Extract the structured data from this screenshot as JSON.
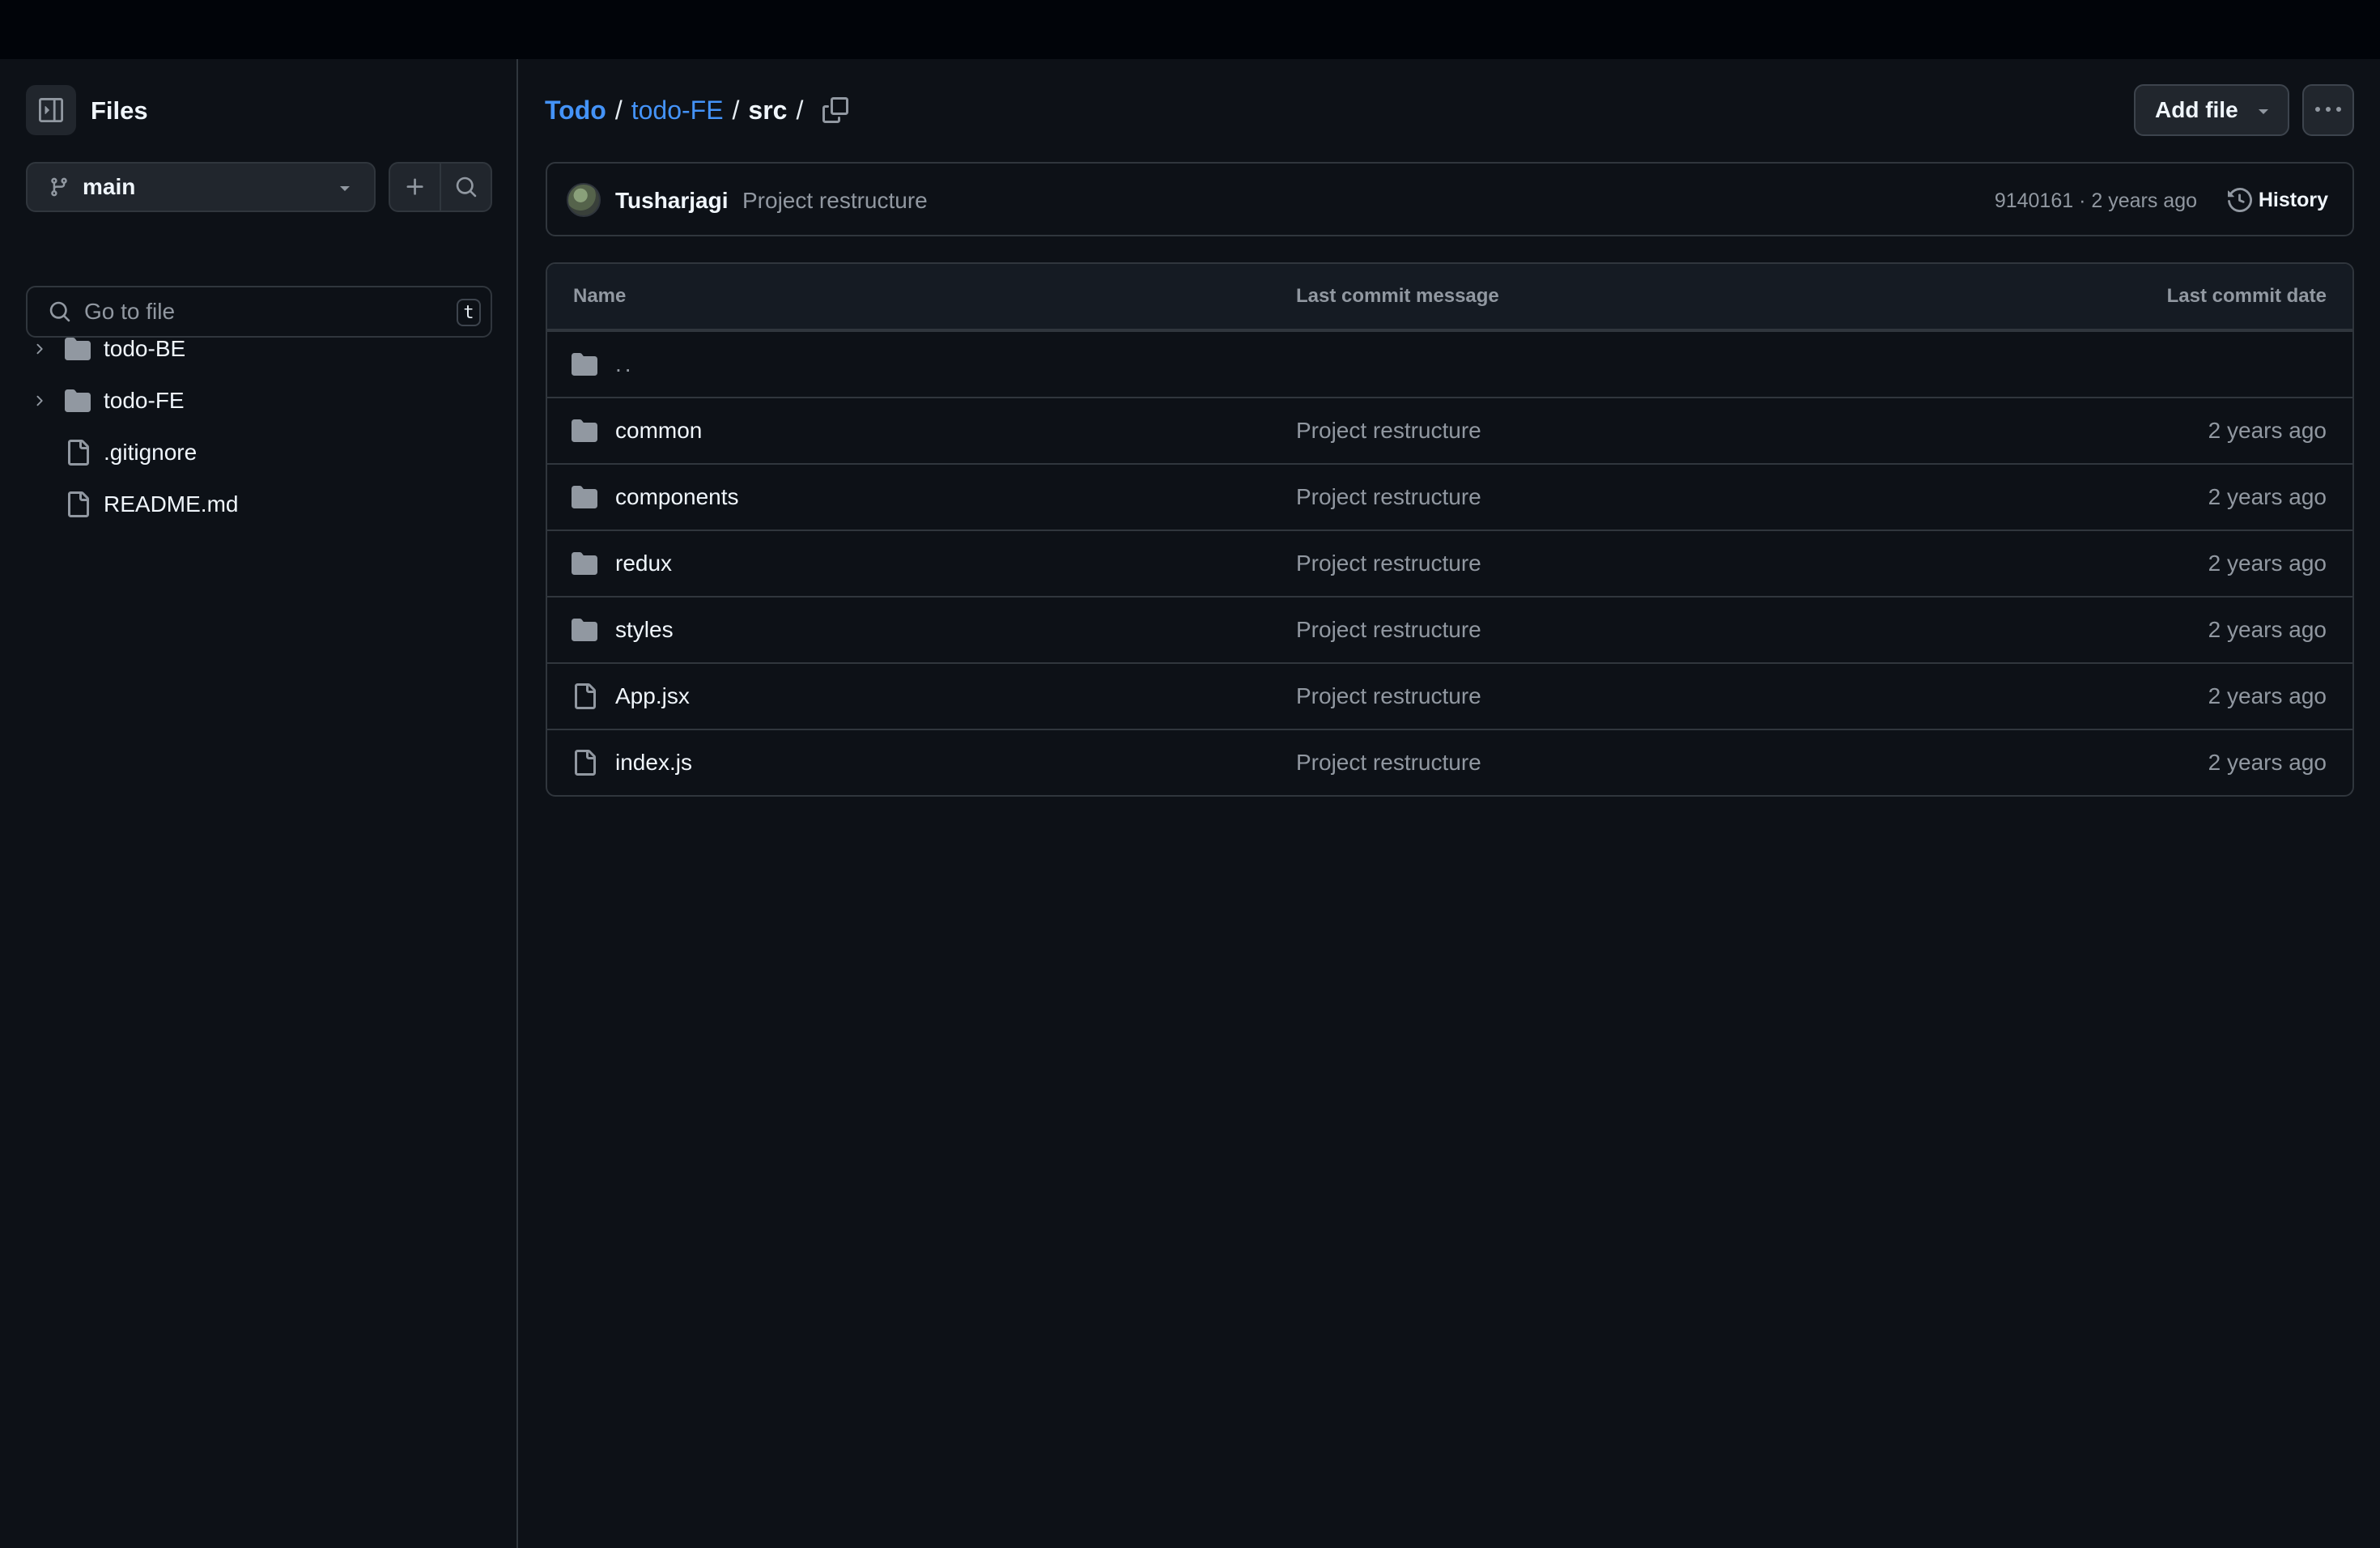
{
  "sidebar": {
    "title": "Files",
    "branch": "main",
    "search_placeholder": "Go to file",
    "search_shortcut": "t",
    "tree": [
      {
        "label": "todo-BE",
        "type": "folder",
        "expandable": true
      },
      {
        "label": "todo-FE",
        "type": "folder",
        "expandable": true
      },
      {
        "label": ".gitignore",
        "type": "file",
        "expandable": false
      },
      {
        "label": "README.md",
        "type": "file",
        "expandable": false
      }
    ]
  },
  "breadcrumb": {
    "repo": "Todo",
    "dir": "todo-FE",
    "current": "src",
    "separator": "/"
  },
  "actions": {
    "add_file": "Add file"
  },
  "commit": {
    "author": "Tusharjagi",
    "message": "Project restructure",
    "meta": "9140161 · 2 years ago",
    "history": "History"
  },
  "table": {
    "headers": {
      "name": "Name",
      "message": "Last commit message",
      "date": "Last commit date"
    },
    "parent": "..",
    "rows": [
      {
        "name": "common",
        "type": "folder",
        "message": "Project restructure",
        "date": "2 years ago"
      },
      {
        "name": "components",
        "type": "folder",
        "message": "Project restructure",
        "date": "2 years ago"
      },
      {
        "name": "redux",
        "type": "folder",
        "message": "Project restructure",
        "date": "2 years ago"
      },
      {
        "name": "styles",
        "type": "folder",
        "message": "Project restructure",
        "date": "2 years ago"
      },
      {
        "name": "App.jsx",
        "type": "file",
        "message": "Project restructure",
        "date": "2 years ago"
      },
      {
        "name": "index.js",
        "type": "file",
        "message": "Project restructure",
        "date": "2 years ago"
      }
    ]
  },
  "colors": {
    "background": "#0d1117",
    "topbar": "#010409",
    "border": "#30363d",
    "link": "#4493f8",
    "muted_text": "#9198a1"
  }
}
